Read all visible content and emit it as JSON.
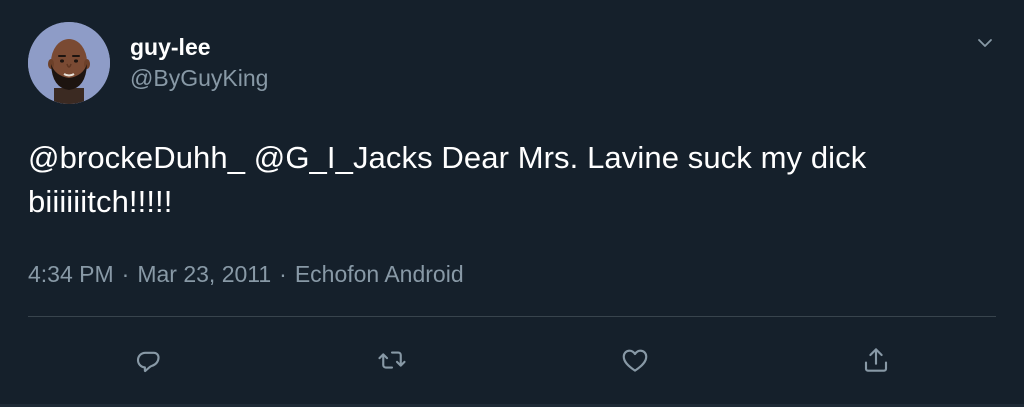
{
  "tweet": {
    "display_name": "guy-lee",
    "handle": "@ByGuyKing",
    "text": "@brockeDuhh_ @G_I_Jacks Dear Mrs. Lavine suck my dick biiiiiitch!!!!!",
    "time": "4:34 PM",
    "separator": "·",
    "date": "Mar 23, 2011",
    "source": "Echofon Android"
  },
  "icons": {
    "more": "chevron-down-icon",
    "reply": "reply-icon",
    "retweet": "retweet-icon",
    "like": "like-icon",
    "share": "share-icon"
  },
  "colors": {
    "background": "#15202b",
    "primary_text": "#ffffff",
    "secondary_text": "#8899a6",
    "divider": "#38444d",
    "avatar_bg": "#8e9cc7"
  }
}
